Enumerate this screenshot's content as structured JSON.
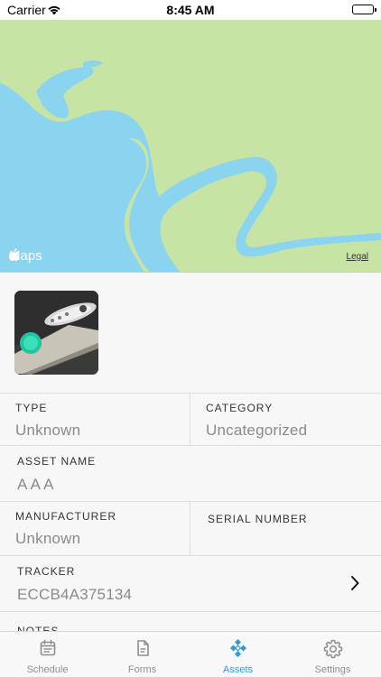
{
  "status_bar": {
    "carrier": "Carrier",
    "time": "8:45 AM"
  },
  "map": {
    "logo_text": "Maps",
    "legal": "Legal",
    "colors": {
      "land": "#c7e4a5",
      "water": "#8ad4f0"
    }
  },
  "asset": {
    "type_label": "TYPE",
    "type_value": "Unknown",
    "category_label": "CATEGORY",
    "category_value": "Uncategorized",
    "name_label": "ASSET NAME",
    "name_value": "A A A",
    "manufacturer_label": "MANUFACTURER",
    "manufacturer_value": "Unknown",
    "serial_label": "SERIAL NUMBER",
    "serial_value": "",
    "tracker_label": "TRACKER",
    "tracker_value": "ECCB4A375134",
    "notes_label": "NOTES"
  },
  "tabbar": {
    "accent": "#2a9fd6",
    "tabs": [
      {
        "label": "Schedule",
        "icon": "calendar-icon"
      },
      {
        "label": "Forms",
        "icon": "document-icon"
      },
      {
        "label": "Assets",
        "icon": "assets-icon",
        "active": true
      },
      {
        "label": "Settings",
        "icon": "gear-icon"
      }
    ]
  }
}
